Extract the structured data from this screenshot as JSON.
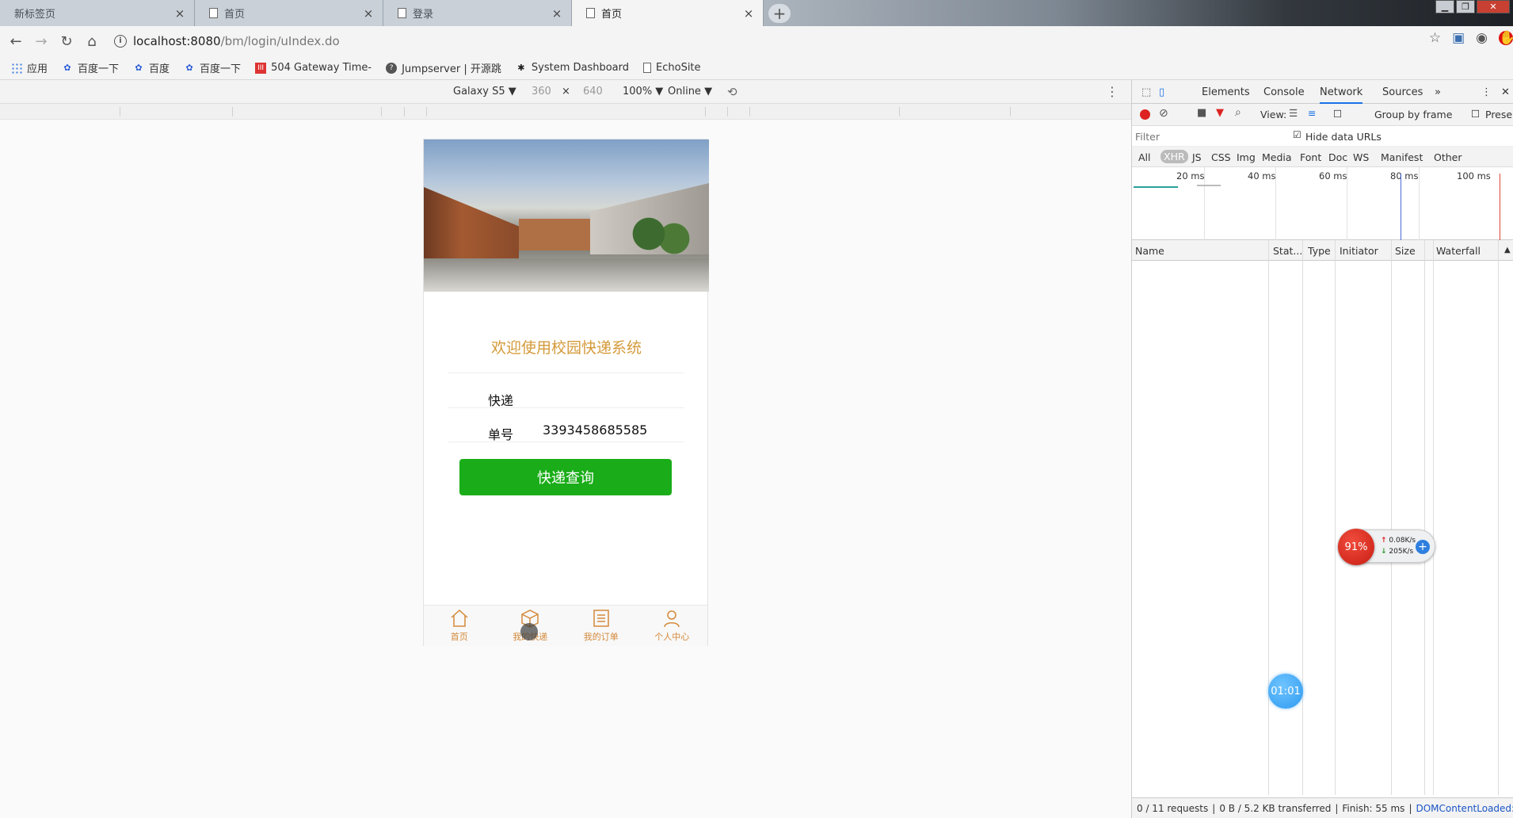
{
  "browser": {
    "tabs": [
      {
        "title": "新标签页",
        "active": false
      },
      {
        "title": "首页",
        "active": false
      },
      {
        "title": "登录",
        "active": false
      },
      {
        "title": "首页",
        "active": true
      }
    ],
    "new_tab": "+",
    "address": {
      "host": "localhost:8080",
      "path": "/bm/login/uIndex.do"
    },
    "bookmarks": [
      {
        "label": "应用",
        "icon": "apps-icon"
      },
      {
        "label": "百度一下",
        "icon": "baidu-paw-icon"
      },
      {
        "label": "百度",
        "icon": "baidu-paw-icon"
      },
      {
        "label": "百度一下",
        "icon": "baidu-paw-icon"
      },
      {
        "label": "504 Gateway Time-",
        "icon": "tile-icon"
      },
      {
        "label": "Jumpserver | 开源跳",
        "icon": "jumpserver-icon"
      },
      {
        "label": "System Dashboard",
        "icon": "kubernetes-icon"
      },
      {
        "label": "EchoSite",
        "icon": "page-icon"
      }
    ]
  },
  "device_toolbar": {
    "device": "Galaxy S5 ▼",
    "width": "360",
    "times": "×",
    "height": "640",
    "zoom": "100% ▼",
    "network": "Online ▼"
  },
  "app": {
    "welcome": "欢迎使用校园快递系统",
    "fields": [
      {
        "label": "快递",
        "value": ""
      },
      {
        "label": "单号",
        "value": "3393458685585"
      }
    ],
    "query_button": "快递查询",
    "tabbar": [
      {
        "label": "首页",
        "icon": "home-icon"
      },
      {
        "label": "我的快递",
        "icon": "package-icon"
      },
      {
        "label": "我的订单",
        "icon": "orders-icon"
      },
      {
        "label": "个人中心",
        "icon": "user-icon"
      }
    ]
  },
  "devtools": {
    "panels": [
      "Elements",
      "Console",
      "Network",
      "Sources",
      "»"
    ],
    "active_panel": "Network",
    "toolbar": {
      "view_label": "View:",
      "group_by_frame": "Group by frame",
      "preserve": "Preserv"
    },
    "filter": {
      "placeholder": "Filter",
      "hide_data_urls": "Hide data URLs"
    },
    "types": [
      "All",
      "XHR",
      "JS",
      "CSS",
      "Img",
      "Media",
      "Font",
      "Doc",
      "WS",
      "Manifest",
      "Other"
    ],
    "active_type": "XHR",
    "timeline_ticks": [
      "20 ms",
      "40 ms",
      "60 ms",
      "80 ms",
      "100 ms"
    ],
    "columns": [
      "Name",
      "Stat...",
      "Type",
      "Initiator",
      "Size",
      "Waterfall"
    ],
    "status": {
      "requests": "0 / 11 requests",
      "transferred": "0 B / 5.2 KB transferred",
      "finish": "Finish: 55 ms",
      "dcl": "DOMContentLoaded: ..."
    }
  },
  "overlay": {
    "cpu_percent": "91%",
    "upload": "0.08K/s",
    "download": "205K/s",
    "timer": "01:01"
  },
  "colors": {
    "accent_orange": "#d49a3a",
    "button_green": "#1aad19",
    "record_red": "#d22222",
    "devtools_blue": "#1a73e8"
  }
}
